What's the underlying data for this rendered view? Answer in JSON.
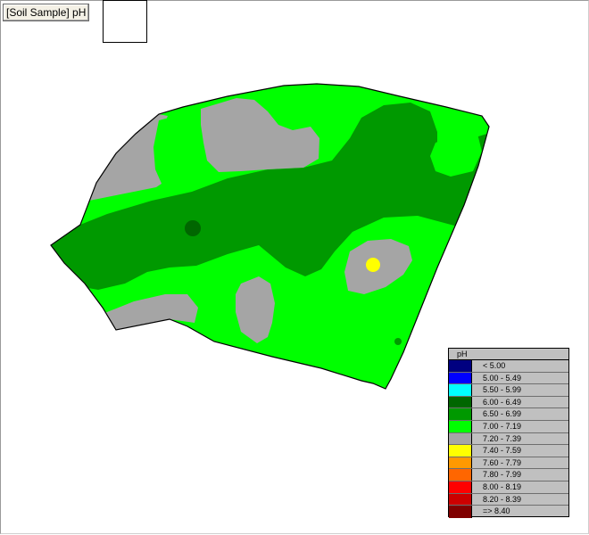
{
  "layer_title": "[Soil Sample] pH",
  "legend": {
    "title": "pH",
    "items": [
      {
        "range": "< 5.00",
        "color": "#000080"
      },
      {
        "range": "5.00 - 5.49",
        "color": "#0000ff"
      },
      {
        "range": "5.50 - 5.99",
        "color": "#00ffff"
      },
      {
        "range": "6.00 - 6.49",
        "color": "#006600"
      },
      {
        "range": "6.50 - 6.99",
        "color": "#009900"
      },
      {
        "range": "7.00 - 7.19",
        "color": "#00ff00"
      },
      {
        "range": "7.20 - 7.39",
        "color": "#a5a5a5"
      },
      {
        "range": "7.40 - 7.59",
        "color": "#ffff00"
      },
      {
        "range": "7.60 - 7.79",
        "color": "#ff9900"
      },
      {
        "range": "7.80 - 7.99",
        "color": "#ff6600"
      },
      {
        "range": "8.00 - 8.19",
        "color": "#ff0000"
      },
      {
        "range": "8.20 - 8.39",
        "color": "#cc0000"
      },
      {
        "range": "=> 8.40",
        "color": "#800000"
      }
    ]
  },
  "map_colors": {
    "field_base": "#00ff00",
    "band": "#009900",
    "spot_dark": "#006600",
    "gray_zone": "#a5a5a5",
    "spot_yellow": "#ffff00",
    "outline": "#000000"
  }
}
